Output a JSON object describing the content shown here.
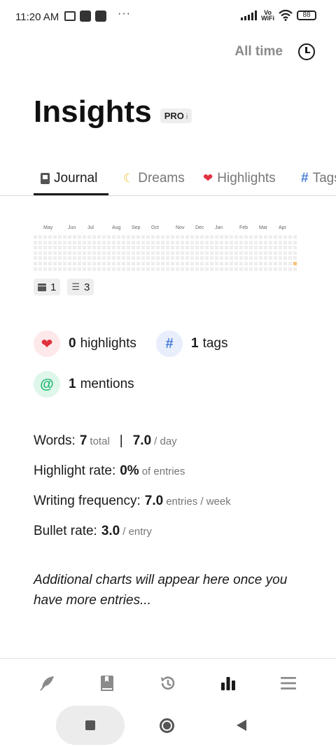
{
  "status_bar": {
    "time": "11:20 AM",
    "vowifi_line1": "Vo",
    "vowifi_line2": "WiFi",
    "battery": "88"
  },
  "header": {
    "filter_label": "All time",
    "title": "Insights",
    "badge": "PRO",
    "badge_info": "i"
  },
  "tabs": [
    {
      "label": "Journal",
      "icon": "book-icon",
      "active": true
    },
    {
      "label": "Dreams",
      "icon": "moon-icon",
      "active": false
    },
    {
      "label": "Highlights",
      "icon": "heart-icon",
      "active": false
    },
    {
      "label": "Tags",
      "icon": "hash-icon",
      "active": false
    }
  ],
  "heatmap": {
    "months": [
      "May",
      "Jun",
      "Jul",
      "Aug",
      "Sep",
      "Oct",
      "Nov",
      "Dec",
      "Jan",
      "Feb",
      "Mar",
      "Apr"
    ],
    "active_color": "#f6c27a",
    "empty_color": "#eeeeee"
  },
  "chips": {
    "days_count": "1",
    "bullets_count": "3"
  },
  "stats": {
    "highlights_count": "0",
    "highlights_label": "highlights",
    "tags_count": "1",
    "tags_label": "tags",
    "mentions_count": "1",
    "mentions_label": "mentions"
  },
  "metrics": {
    "words_label": "Words:",
    "words_total": "7",
    "words_total_unit": "total",
    "words_sep": "|",
    "words_per_day": "7.0",
    "words_per_day_unit": "/ day",
    "highlight_rate_label": "Highlight rate:",
    "highlight_rate": "0%",
    "highlight_rate_unit": "of entries",
    "writing_frequency_label": "Writing frequency:",
    "writing_frequency": "7.0",
    "writing_frequency_unit": "entries / week",
    "bullet_rate_label": "Bullet rate:",
    "bullet_rate": "3.0",
    "bullet_rate_unit": "/ entry"
  },
  "note": "Additional charts will appear here once you have more entries...",
  "bottom_nav": [
    {
      "icon": "feather-icon",
      "active": false
    },
    {
      "icon": "journal-book-icon",
      "active": false
    },
    {
      "icon": "history-icon",
      "active": false
    },
    {
      "icon": "bar-chart-icon",
      "active": true
    },
    {
      "icon": "menu-icon",
      "active": false
    }
  ]
}
